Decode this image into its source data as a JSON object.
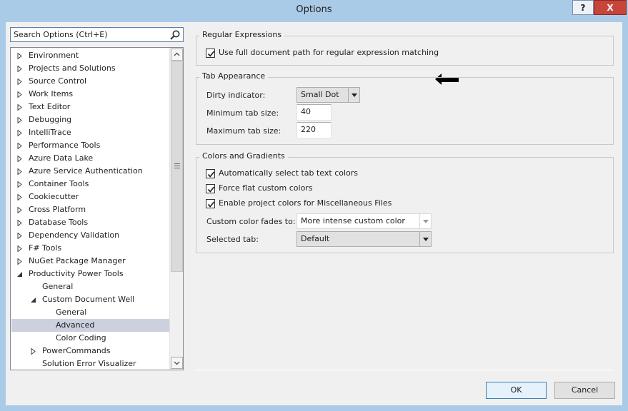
{
  "window": {
    "title": "Options",
    "help_label": "?",
    "close_label": "X"
  },
  "search": {
    "placeholder": "Search Options (Ctrl+E)"
  },
  "tree": {
    "items": [
      {
        "label": "Environment",
        "level": 0,
        "arrow": "collapsed",
        "selected": false
      },
      {
        "label": "Projects and Solutions",
        "level": 0,
        "arrow": "collapsed",
        "selected": false
      },
      {
        "label": "Source Control",
        "level": 0,
        "arrow": "collapsed",
        "selected": false
      },
      {
        "label": "Work Items",
        "level": 0,
        "arrow": "collapsed",
        "selected": false
      },
      {
        "label": "Text Editor",
        "level": 0,
        "arrow": "collapsed",
        "selected": false
      },
      {
        "label": "Debugging",
        "level": 0,
        "arrow": "collapsed",
        "selected": false
      },
      {
        "label": "IntelliTrace",
        "level": 0,
        "arrow": "collapsed",
        "selected": false
      },
      {
        "label": "Performance Tools",
        "level": 0,
        "arrow": "collapsed",
        "selected": false
      },
      {
        "label": "Azure Data Lake",
        "level": 0,
        "arrow": "collapsed",
        "selected": false
      },
      {
        "label": "Azure Service Authentication",
        "level": 0,
        "arrow": "collapsed",
        "selected": false
      },
      {
        "label": "Container Tools",
        "level": 0,
        "arrow": "collapsed",
        "selected": false
      },
      {
        "label": "Cookiecutter",
        "level": 0,
        "arrow": "collapsed",
        "selected": false
      },
      {
        "label": "Cross Platform",
        "level": 0,
        "arrow": "collapsed",
        "selected": false
      },
      {
        "label": "Database Tools",
        "level": 0,
        "arrow": "collapsed",
        "selected": false
      },
      {
        "label": "Dependency Validation",
        "level": 0,
        "arrow": "collapsed",
        "selected": false
      },
      {
        "label": "F# Tools",
        "level": 0,
        "arrow": "collapsed",
        "selected": false
      },
      {
        "label": "NuGet Package Manager",
        "level": 0,
        "arrow": "collapsed",
        "selected": false
      },
      {
        "label": "Productivity Power Tools",
        "level": 0,
        "arrow": "expanded",
        "selected": false
      },
      {
        "label": "General",
        "level": 1,
        "arrow": "none",
        "selected": false
      },
      {
        "label": "Custom Document Well",
        "level": 1,
        "arrow": "expanded",
        "selected": false
      },
      {
        "label": "General",
        "level": 2,
        "arrow": "none",
        "selected": false
      },
      {
        "label": "Advanced",
        "level": 2,
        "arrow": "none",
        "selected": true
      },
      {
        "label": "Color Coding",
        "level": 2,
        "arrow": "none",
        "selected": false
      },
      {
        "label": "PowerCommands",
        "level": 1,
        "arrow": "collapsed",
        "selected": false
      },
      {
        "label": "Solution Error Visualizer",
        "level": 1,
        "arrow": "none",
        "selected": false
      }
    ]
  },
  "regex_group": {
    "title": "Regular Expressions",
    "use_full_path": {
      "label": "Use full document path for regular expression matching",
      "checked": true
    }
  },
  "tab_group": {
    "title": "Tab Appearance",
    "dirty_label": "Dirty indicator:",
    "dirty_value": "Small Dot",
    "min_label": "Minimum tab size:",
    "min_value": "40",
    "max_label": "Maximum tab size:",
    "max_value": "220"
  },
  "colors_group": {
    "title": "Colors and Gradients",
    "auto_select": {
      "label": "Automatically select tab text colors",
      "checked": true
    },
    "force_flat": {
      "label": "Force flat custom colors",
      "checked": true
    },
    "project_colors": {
      "label": "Enable project colors for Miscellaneous Files",
      "checked": true
    },
    "fade_label": "Custom color fades to:",
    "fade_value": "More intense custom color",
    "selected_label": "Selected tab:",
    "selected_value": "Default"
  },
  "buttons": {
    "ok": "OK",
    "cancel": "Cancel"
  },
  "colors": {
    "frame": "#aacbe8",
    "client": "#f0f0f0",
    "selection": "#cdd0de",
    "close": "#c7453a",
    "ok_border": "#3c7fb1"
  }
}
